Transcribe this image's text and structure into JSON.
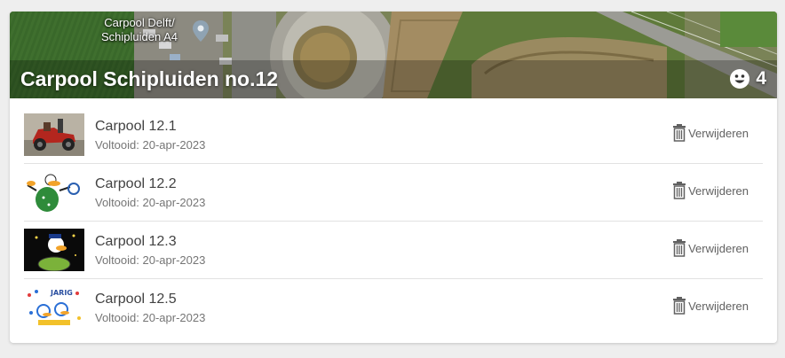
{
  "group": {
    "title": "Carpool Schipluiden no.12",
    "member_count": "4",
    "map_label_line1": "Carpool Delft/",
    "map_label_line2": "Schipluiden A4"
  },
  "items": [
    {
      "title": "Carpool 12.1",
      "status": "Voltooid: 20-apr-2023",
      "delete_label": "Verwijderen",
      "thumbnail": "red-vintage-car"
    },
    {
      "title": "Carpool 12.2",
      "status": "Voltooid: 20-apr-2023",
      "delete_label": "Verwijderen",
      "thumbnail": "cartoon-duck-green"
    },
    {
      "title": "Carpool 12.3",
      "status": "Voltooid: 20-apr-2023",
      "delete_label": "Verwijderen",
      "thumbnail": "cartoon-duck-night"
    },
    {
      "title": "Carpool 12.5",
      "status": "Voltooid: 20-apr-2023",
      "delete_label": "Verwijderen",
      "thumbnail": "cartoon-jarig-birthday"
    }
  ],
  "icons": {
    "members": "smiley-icon",
    "delete": "trash-icon",
    "map": "map-pin-icon"
  },
  "colors": {
    "title_text": "#ffffff",
    "item_text": "#424242",
    "muted_text": "#757575"
  }
}
